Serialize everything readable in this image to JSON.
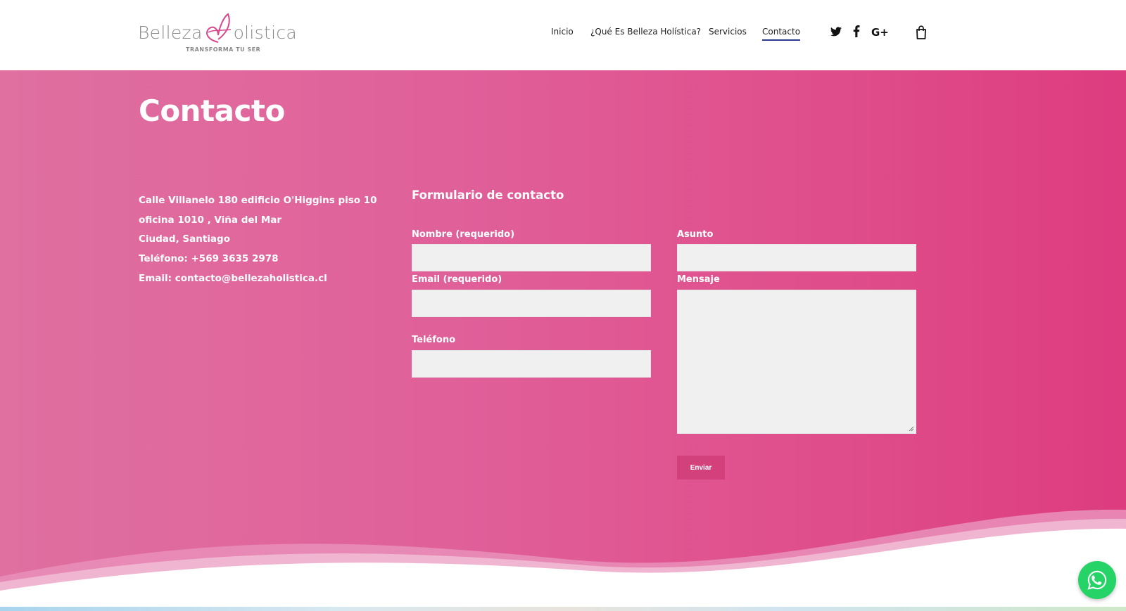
{
  "brand": {
    "logo_word1": "Belleza",
    "logo_word2": "olistica",
    "tagline": "TRANSFORMA TU SER",
    "logo_color": "#8a8a8a",
    "accent_color": "#e0609a"
  },
  "nav": {
    "items": [
      {
        "label": "Inicio"
      },
      {
        "label": "¿Qué Es Belleza Holística?"
      },
      {
        "label": "Servicios"
      },
      {
        "label": "Contacto"
      }
    ],
    "active": "Contacto",
    "social_icons": [
      "twitter-icon",
      "facebook-icon",
      "google-plus-icon"
    ],
    "google_plus_glyph": "G+",
    "cart_icon": "shopping-bag-icon"
  },
  "page": {
    "title": "Contacto"
  },
  "contact_info": {
    "lines": [
      "Calle Villanelo 180 edificio O'Higgins piso 10",
      "oficina 1010 , Viña del Mar",
      "Ciudad, Santiago",
      "Teléfono: +569 3635 2978",
      "Email: contacto@bellezaholistica.cl"
    ]
  },
  "form": {
    "title": "Formulario de contacto",
    "fields": {
      "name": {
        "label": "Nombre (requerido)",
        "value": ""
      },
      "email": {
        "label": "Email (requerido)",
        "value": ""
      },
      "phone": {
        "label": "Teléfono",
        "value": ""
      },
      "subject": {
        "label": "Asunto",
        "value": ""
      },
      "message": {
        "label": "Mensaje",
        "value": ""
      }
    },
    "submit_label": "Enviar"
  },
  "floating": {
    "whatsapp_icon": "whatsapp-icon",
    "whatsapp_color": "#25d366"
  }
}
